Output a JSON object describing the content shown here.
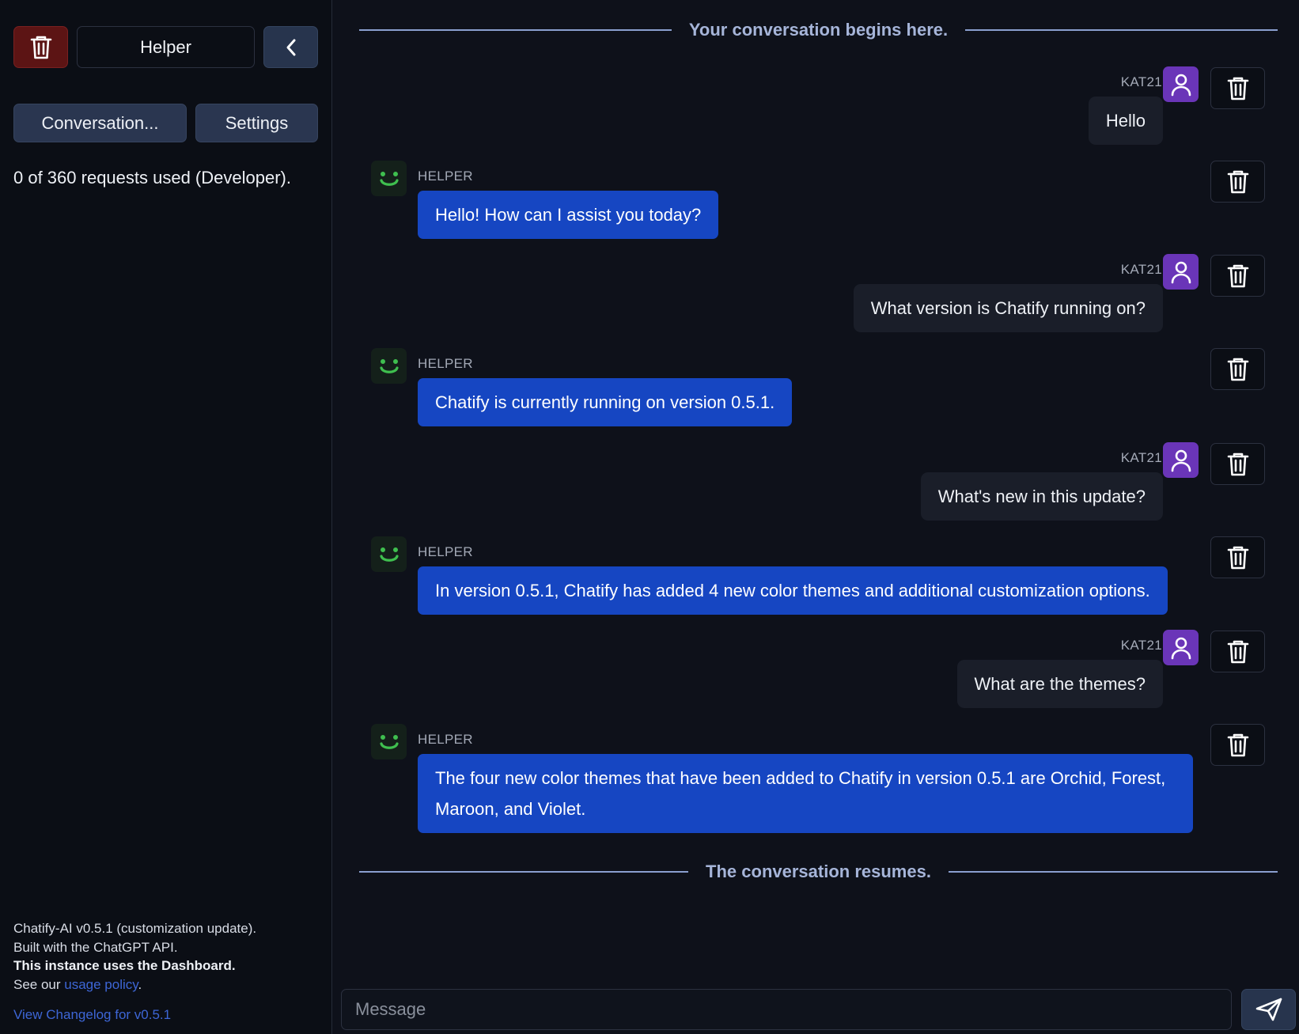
{
  "sidebar": {
    "name_value": "Helper",
    "tabs": [
      {
        "label": "Conversation..."
      },
      {
        "label": "Settings"
      }
    ],
    "usage_text": "0 of 360 requests used (Developer).",
    "footer": {
      "line1": "Chatify-AI v0.5.1 (customization update).",
      "line2": "Built with the ChatGPT API.",
      "line3": "This instance uses the Dashboard.",
      "line4_prefix": "See our ",
      "line4_link": "usage policy",
      "line4_suffix": "."
    },
    "changelog_link": "View Changelog for v0.5.1"
  },
  "conversation": {
    "start_label": "Your conversation begins here.",
    "end_label": "The conversation resumes.",
    "messages": [
      {
        "role": "user",
        "sender": "KAT21",
        "text": "Hello"
      },
      {
        "role": "bot",
        "sender": "HELPER",
        "text": "Hello! How can I assist you today?"
      },
      {
        "role": "user",
        "sender": "KAT21",
        "text": "What version is Chatify running on?"
      },
      {
        "role": "bot",
        "sender": "HELPER",
        "text": "Chatify is currently running on version 0.5.1."
      },
      {
        "role": "user",
        "sender": "KAT21",
        "text": "What's new in this update?"
      },
      {
        "role": "bot",
        "sender": "HELPER",
        "text": "In version 0.5.1, Chatify has added 4 new color themes and additional customization options."
      },
      {
        "role": "user",
        "sender": "KAT21",
        "text": "What are the themes?"
      },
      {
        "role": "bot",
        "sender": "HELPER",
        "text": "The four new color themes that have been added to Chatify in version 0.5.1 are Orchid, Forest, Maroon, and Violet."
      }
    ]
  },
  "composer": {
    "placeholder": "Message",
    "value": ""
  },
  "icons": {
    "delete": "trash-icon",
    "collapse": "chevron-left-icon",
    "user_avatar": "user-icon",
    "bot_avatar": "smiley-icon",
    "send": "send-icon"
  },
  "colors": {
    "background": "#0e111a",
    "sidebar": "#0b0e15",
    "bot_bubble": "#1646c2",
    "user_bubble": "#1a1e29",
    "user_avatar": "#6a35b8",
    "danger": "#5c1414",
    "accent_button": "#27344d",
    "link": "#3d66d6",
    "smiley": "#3fbf4f"
  }
}
